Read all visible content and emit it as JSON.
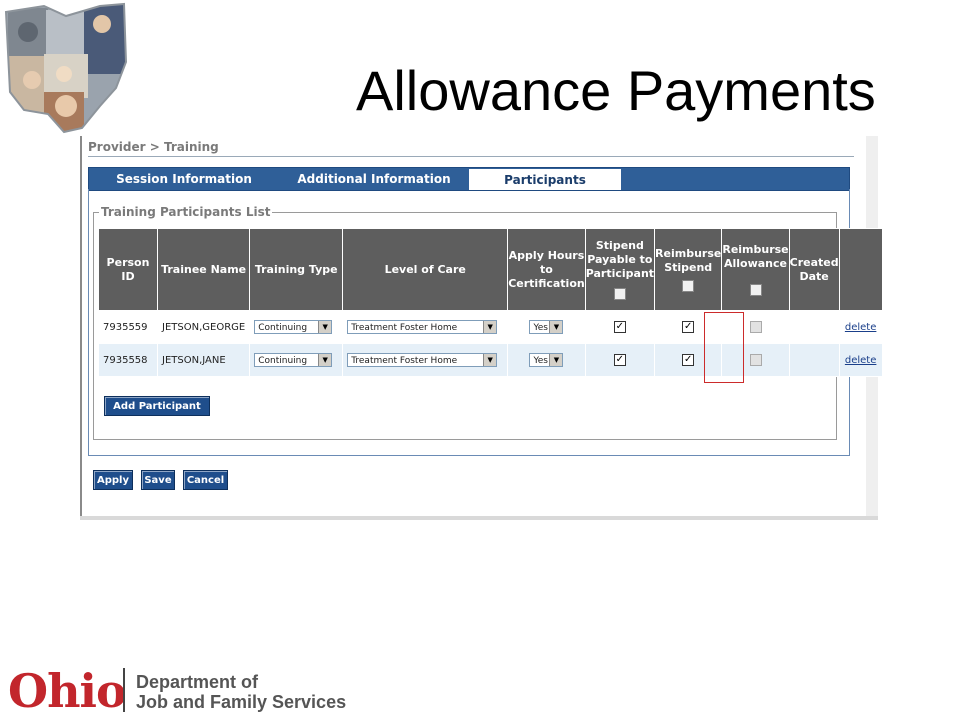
{
  "slide": {
    "title": "Allowance Payments"
  },
  "breadcrumb": "Provider > Training",
  "tabs": [
    {
      "label": "Session Information",
      "active": false
    },
    {
      "label": "Additional Information",
      "active": false
    },
    {
      "label": "Participants",
      "active": true
    }
  ],
  "section": {
    "legend": "Training Participants List"
  },
  "table": {
    "headers": [
      "Person ID",
      "Trainee Name",
      "Training Type",
      "Level of Care",
      "Apply Hours to Certification",
      "Stipend Payable to Participant",
      "Reimburse Stipend",
      "Reimburse Allowance",
      "Created Date",
      ""
    ],
    "rows": [
      {
        "person_id": "7935559",
        "name": "JETSON,GEORGE",
        "training_type": "Continuing",
        "level_of_care": "Treatment Foster Home",
        "apply_hours": "Yes",
        "stipend_payable": true,
        "reimburse_stipend": true,
        "reimburse_allowance": false,
        "created_date": "",
        "action": "delete"
      },
      {
        "person_id": "7935558",
        "name": "JETSON,JANE",
        "training_type": "Continuing",
        "level_of_care": "Treatment Foster Home",
        "apply_hours": "Yes",
        "stipend_payable": true,
        "reimburse_stipend": true,
        "reimburse_allowance": false,
        "created_date": "",
        "action": "delete"
      }
    ]
  },
  "buttons": {
    "add_participant": "Add Participant",
    "apply": "Apply",
    "save": "Save",
    "cancel": "Cancel"
  },
  "footer": {
    "brand": "Ohio",
    "dept_line1": "Department of",
    "dept_line2": "Job and Family Services"
  },
  "icons": {
    "dropdown": "chevron-down-icon",
    "checkbox": "checkbox-icon"
  },
  "colors": {
    "tab_bar": "#2f5f98",
    "header_bg": "#5e5e5e",
    "row_alt": "#e6f0f8",
    "highlight": "#cc2b2b",
    "ohio_red": "#c2262c"
  }
}
